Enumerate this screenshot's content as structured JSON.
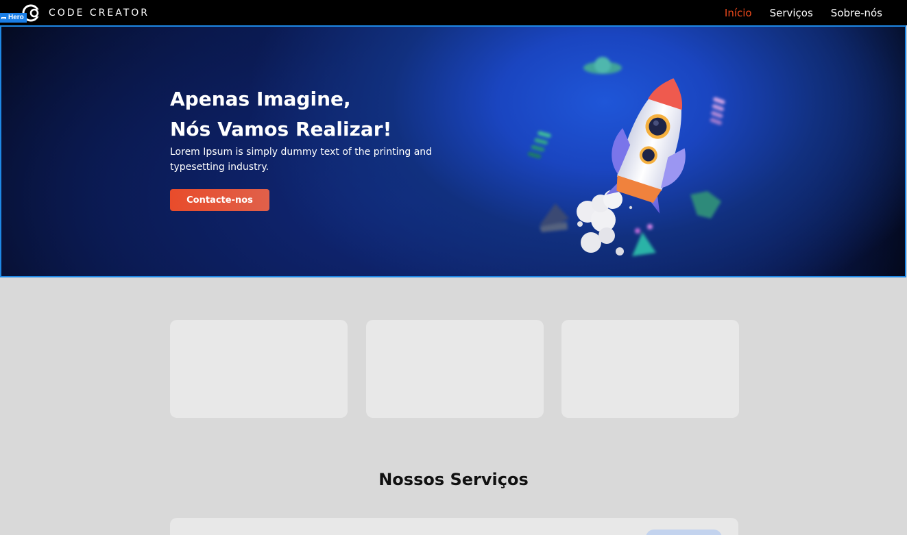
{
  "brand": {
    "name": "CODE CREATOR",
    "logo_icon": "code-creator-logo-icon"
  },
  "nav": {
    "items": [
      {
        "label": "Início",
        "active": true
      },
      {
        "label": "Serviços",
        "active": false
      },
      {
        "label": "Sobre-nós",
        "active": false
      }
    ]
  },
  "editor": {
    "selected_label": "Hero"
  },
  "hero": {
    "title_line1": "Apenas Imagine,",
    "title_line2": "Nós Vamos Realizar!",
    "text": "Lorem Ipsum is simply dummy text of the printing and typesetting industry.",
    "cta_label": "Contacte-nos",
    "illustration": "rocket-illustration"
  },
  "services": {
    "title": "Nossos Serviços"
  },
  "colors": {
    "accent": "#f04a1c",
    "button": "#e84c2b",
    "selection": "#1e88e5",
    "background": "#d9d9d9",
    "card": "#e8e8e8"
  }
}
